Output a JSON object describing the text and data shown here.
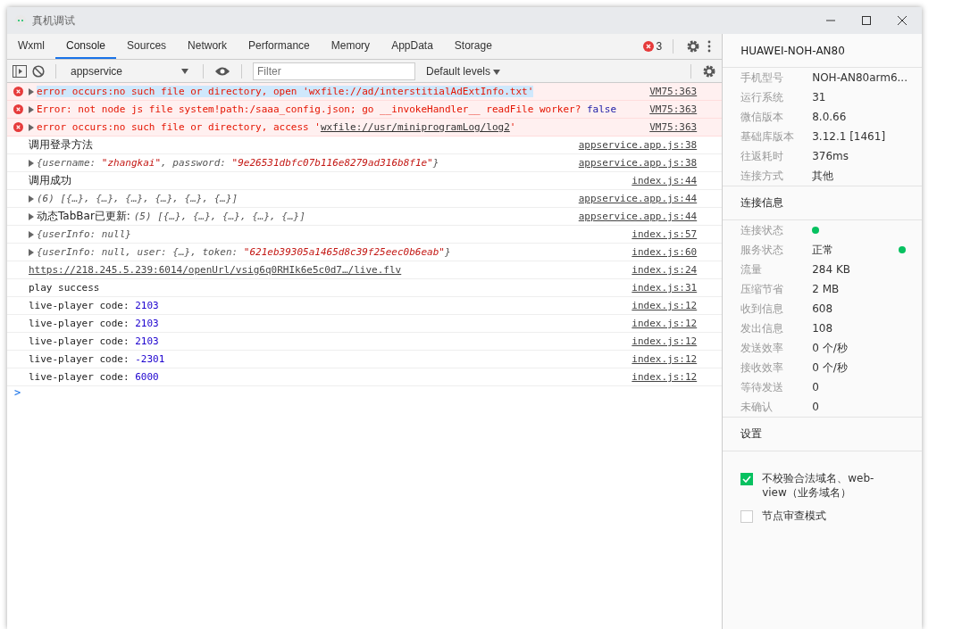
{
  "window": {
    "title": "真机调试"
  },
  "tabs": [
    {
      "label": "Wxml",
      "selected": false
    },
    {
      "label": "Console",
      "selected": true
    },
    {
      "label": "Sources",
      "selected": false
    },
    {
      "label": "Network",
      "selected": false
    },
    {
      "label": "Performance",
      "selected": false
    },
    {
      "label": "Memory",
      "selected": false
    },
    {
      "label": "AppData",
      "selected": false
    },
    {
      "label": "Storage",
      "selected": false
    }
  ],
  "error_count": "3",
  "toolbar": {
    "context": "appservice",
    "filter_placeholder": "Filter",
    "levels": "Default levels"
  },
  "console": [
    {
      "kind": "error",
      "expanded": false,
      "source": "VM75:363",
      "parts": [
        {
          "kind": "error",
          "text": "error occurs:no such file or directory, open 'wxfile://ad/interstitialAdExtInfo.txt'",
          "highlighted": true
        }
      ]
    },
    {
      "kind": "error",
      "expanded": false,
      "source": "VM75:363",
      "parts": [
        {
          "kind": "error",
          "text": "Error: not node js file system!path:/saaa_config.json; go __invokeHandler__ readFile worker? ",
          "highlighted": false
        },
        {
          "kind": "bool",
          "text": "false",
          "highlighted": false
        }
      ]
    },
    {
      "kind": "error",
      "expanded": false,
      "source": "VM75:363",
      "parts": [
        {
          "kind": "error",
          "text": "error occurs:no such file or directory, access '",
          "highlighted": false
        },
        {
          "kind": "errorlink",
          "text": "wxfile://usr/miniprogramLog/log2",
          "highlighted": false
        },
        {
          "kind": "error",
          "text": "'",
          "highlighted": false
        }
      ]
    },
    {
      "kind": "text",
      "source": "appservice.app.js:38",
      "parts": [
        {
          "kind": "plain",
          "text": "调用登录方法",
          "highlighted": false
        }
      ]
    },
    {
      "kind": "object",
      "expanded": false,
      "source": "appservice.app.js:38",
      "parts": [
        {
          "kind": "key",
          "text": "{username: ",
          "highlighted": false
        },
        {
          "kind": "string",
          "text": "\"zhangkai\"",
          "highlighted": false
        },
        {
          "kind": "key",
          "text": ", password: ",
          "highlighted": false
        },
        {
          "kind": "string",
          "text": "\"9e26531dbfc07b116e8279ad316b8f1e\"",
          "highlighted": false
        },
        {
          "kind": "key",
          "text": "}",
          "highlighted": false
        }
      ]
    },
    {
      "kind": "text",
      "source": "index.js:44",
      "parts": [
        {
          "kind": "plain",
          "text": "调用成功",
          "highlighted": false
        }
      ]
    },
    {
      "kind": "object",
      "expanded": false,
      "source": "appservice.app.js:44",
      "parts": [
        {
          "kind": "key",
          "text": "(6) [{…}, {…}, {…}, {…}, {…}, {…}]",
          "highlighted": false
        }
      ]
    },
    {
      "kind": "text",
      "expanded": false,
      "source": "appservice.app.js:44",
      "parts": [
        {
          "kind": "plain",
          "text": "动态TabBar已更新: ",
          "highlighted": false
        },
        {
          "kind": "key",
          "text": "(5) [{…}, {…}, {…}, {…}, {…}]",
          "highlighted": false
        }
      ]
    },
    {
      "kind": "object",
      "expanded": false,
      "source": "index.js:57",
      "parts": [
        {
          "kind": "key",
          "text": "{userInfo: null}",
          "highlighted": false
        }
      ]
    },
    {
      "kind": "object",
      "expanded": false,
      "source": "index.js:60",
      "parts": [
        {
          "kind": "key",
          "text": "{userInfo: null, user: {…}, token: ",
          "highlighted": false
        },
        {
          "kind": "string",
          "text": "\"621eb39305a1465d8c39f25eec0b6eab\"",
          "highlighted": false
        },
        {
          "kind": "key",
          "text": "}",
          "highlighted": false
        }
      ]
    },
    {
      "kind": "mono",
      "source": "index.js:24",
      "parts": [
        {
          "kind": "link",
          "text": "https://218.245.5.239:6014/openUrl/vsig6q0RHIk6e5c0d7…/live.flv",
          "highlighted": false
        }
      ]
    },
    {
      "kind": "mono",
      "source": "index.js:31",
      "parts": [
        {
          "kind": "mono",
          "text": "play success",
          "highlighted": false
        }
      ]
    },
    {
      "kind": "mono",
      "source": "index.js:12",
      "parts": [
        {
          "kind": "mono",
          "text": "live-player code: ",
          "highlighted": false
        },
        {
          "kind": "number",
          "text": "2103",
          "highlighted": false
        }
      ]
    },
    {
      "kind": "mono",
      "source": "index.js:12",
      "parts": [
        {
          "kind": "mono",
          "text": "live-player code: ",
          "highlighted": false
        },
        {
          "kind": "number",
          "text": "2103",
          "highlighted": false
        }
      ]
    },
    {
      "kind": "mono",
      "source": "index.js:12",
      "parts": [
        {
          "kind": "mono",
          "text": "live-player code: ",
          "highlighted": false
        },
        {
          "kind": "number",
          "text": "2103",
          "highlighted": false
        }
      ]
    },
    {
      "kind": "mono",
      "source": "index.js:12",
      "parts": [
        {
          "kind": "mono",
          "text": "live-player code: ",
          "highlighted": false
        },
        {
          "kind": "number",
          "text": "-2301",
          "highlighted": false
        }
      ]
    },
    {
      "kind": "mono",
      "source": "index.js:12",
      "parts": [
        {
          "kind": "mono",
          "text": "live-player code: ",
          "highlighted": false
        },
        {
          "kind": "number",
          "text": "6000",
          "highlighted": false
        }
      ]
    }
  ],
  "prompt": ">",
  "device": {
    "name": "HUAWEI-NOH-AN80",
    "info": [
      {
        "label": "手机型号",
        "value": "NOH-AN80arm6..."
      },
      {
        "label": "运行系统",
        "value": "31"
      },
      {
        "label": "微信版本",
        "value": "8.0.66"
      },
      {
        "label": "基础库版本",
        "value": "3.12.1 [1461]"
      },
      {
        "label": "往返耗时",
        "value": "376ms"
      },
      {
        "label": "连接方式",
        "value": "其他"
      }
    ]
  },
  "connection": {
    "title": "连接信息",
    "info": [
      {
        "label": "连接状态",
        "color": "#07c160"
      },
      {
        "label": "服务状态",
        "value": "正常",
        "color": "#07c160"
      },
      {
        "label": "流量",
        "value": "284 KB"
      },
      {
        "label": "压缩节省",
        "value": "2 MB"
      },
      {
        "label": "收到信息",
        "value": "608"
      },
      {
        "label": "发出信息",
        "value": "108"
      },
      {
        "label": "发送效率",
        "value": "0 个/秒"
      },
      {
        "label": "接收效率",
        "value": "0 个/秒"
      },
      {
        "label": "等待发送",
        "value": "0"
      },
      {
        "label": "未确认",
        "value": "0"
      }
    ]
  },
  "settings": {
    "title": "设置",
    "options": [
      {
        "label": "不校验合法域名、web-view（业务域名）",
        "checked": true
      },
      {
        "label": "节点审查模式",
        "checked": false
      }
    ]
  }
}
